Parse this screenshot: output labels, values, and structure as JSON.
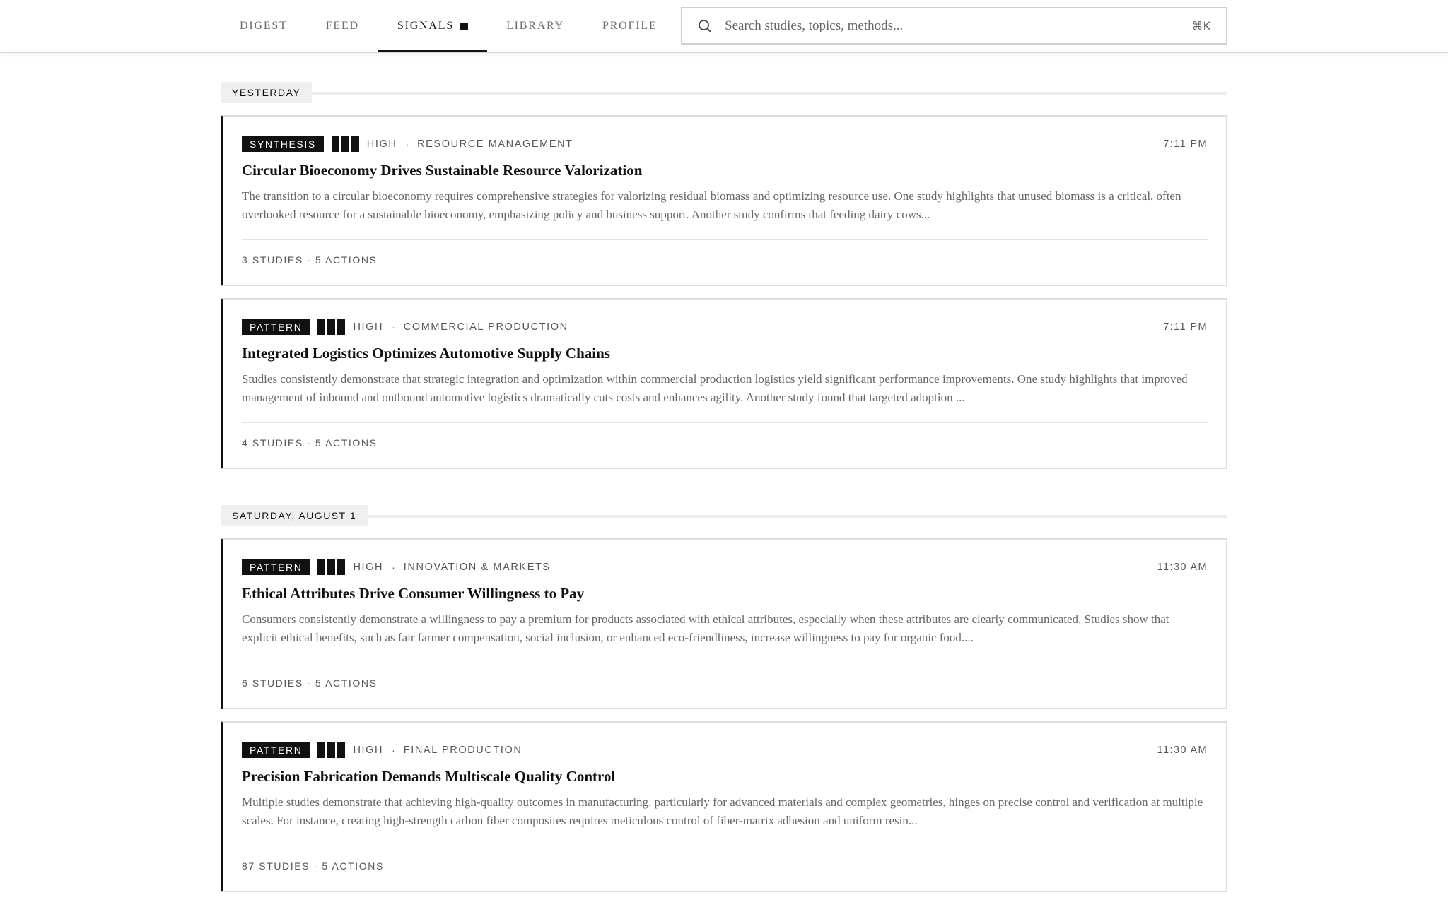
{
  "nav": {
    "tabs": [
      {
        "label": "DIGEST"
      },
      {
        "label": "FEED"
      },
      {
        "label": "SIGNALS"
      },
      {
        "label": "LIBRARY"
      },
      {
        "label": "PROFILE"
      }
    ],
    "active_tab": "SIGNALS"
  },
  "search": {
    "placeholder": "Search studies, topics, methods...",
    "shortcut": "⌘K"
  },
  "groups": [
    {
      "label": "YESTERDAY",
      "cards": [
        {
          "type": "SYNTHESIS",
          "confidence_level": 3,
          "confidence": "HIGH",
          "category": "RESOURCE MANAGEMENT",
          "time": "7:11 PM",
          "title": "Circular Bioeconomy Drives Sustainable Resource Valorization",
          "summary": "The transition to a circular bioeconomy requires comprehensive strategies for valorizing residual biomass and optimizing resource use. One study highlights that unused biomass is a critical, often overlooked resource for a sustainable bioeconomy, emphasizing policy and business support. Another study confirms that feeding dairy cows...",
          "footer": "3 STUDIES · 5 ACTIONS"
        },
        {
          "type": "PATTERN",
          "confidence_level": 3,
          "confidence": "HIGH",
          "category": "COMMERCIAL PRODUCTION",
          "time": "7:11 PM",
          "title": "Integrated Logistics Optimizes Automotive Supply Chains",
          "summary": "Studies consistently demonstrate that strategic integration and optimization within commercial production logistics yield significant performance improvements. One study highlights that improved management of inbound and outbound automotive logistics dramatically cuts costs and enhances agility. Another study found that targeted adoption ...",
          "footer": "4 STUDIES · 5 ACTIONS"
        }
      ]
    },
    {
      "label": "SATURDAY, AUGUST 1",
      "cards": [
        {
          "type": "PATTERN",
          "confidence_level": 3,
          "confidence": "HIGH",
          "category": "INNOVATION & MARKETS",
          "time": "11:30 AM",
          "title": "Ethical Attributes Drive Consumer Willingness to Pay",
          "summary": "Consumers consistently demonstrate a willingness to pay a premium for products associated with ethical attributes, especially when these attributes are clearly communicated. Studies show that explicit ethical benefits, such as fair farmer compensation, social inclusion, or enhanced eco-friendliness, increase willingness to pay for organic food....",
          "footer": "6 STUDIES · 5 ACTIONS"
        },
        {
          "type": "PATTERN",
          "confidence_level": 3,
          "confidence": "HIGH",
          "category": "FINAL PRODUCTION",
          "time": "11:30 AM",
          "title": "Precision Fabrication Demands Multiscale Quality Control",
          "summary": "Multiple studies demonstrate that achieving high-quality outcomes in manufacturing, particularly for advanced materials and complex geometries, hinges on precise control and verification at multiple scales. For instance, creating high-strength carbon fiber composites requires meticulous control of fiber-matrix adhesion and uniform resin...",
          "footer": "87 STUDIES · 5 ACTIONS"
        }
      ]
    }
  ]
}
